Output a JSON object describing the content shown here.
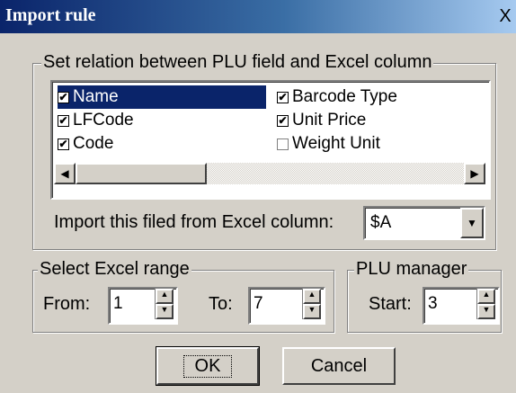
{
  "window": {
    "title": "Import rule",
    "close_glyph": "X"
  },
  "relation_group": {
    "legend": "Set relation between PLU field and Excel column",
    "items_left": [
      {
        "label": "Name",
        "checked": true,
        "selected": true
      },
      {
        "label": "LFCode",
        "checked": true
      },
      {
        "label": "Code",
        "checked": true
      }
    ],
    "items_right": [
      {
        "label": "Barcode Type",
        "checked": true
      },
      {
        "label": "Unit Price",
        "checked": true
      },
      {
        "label": "Weight Unit",
        "checked": false
      }
    ],
    "import_label": "Import this filed from Excel column:",
    "column_value": "$A"
  },
  "range_group": {
    "legend": "Select Excel range",
    "from_label": "From:",
    "from_value": "1",
    "to_label": "To:",
    "to_value": "7"
  },
  "plu_group": {
    "legend": "PLU manager",
    "start_label": "Start:",
    "start_value": "3"
  },
  "buttons": {
    "ok": "OK",
    "cancel": "Cancel"
  },
  "icons": {
    "check": "✔",
    "arrow_left": "◀",
    "arrow_right": "▶",
    "arrow_down": "▼",
    "arrow_up_small": "▲",
    "arrow_down_small": "▼"
  }
}
